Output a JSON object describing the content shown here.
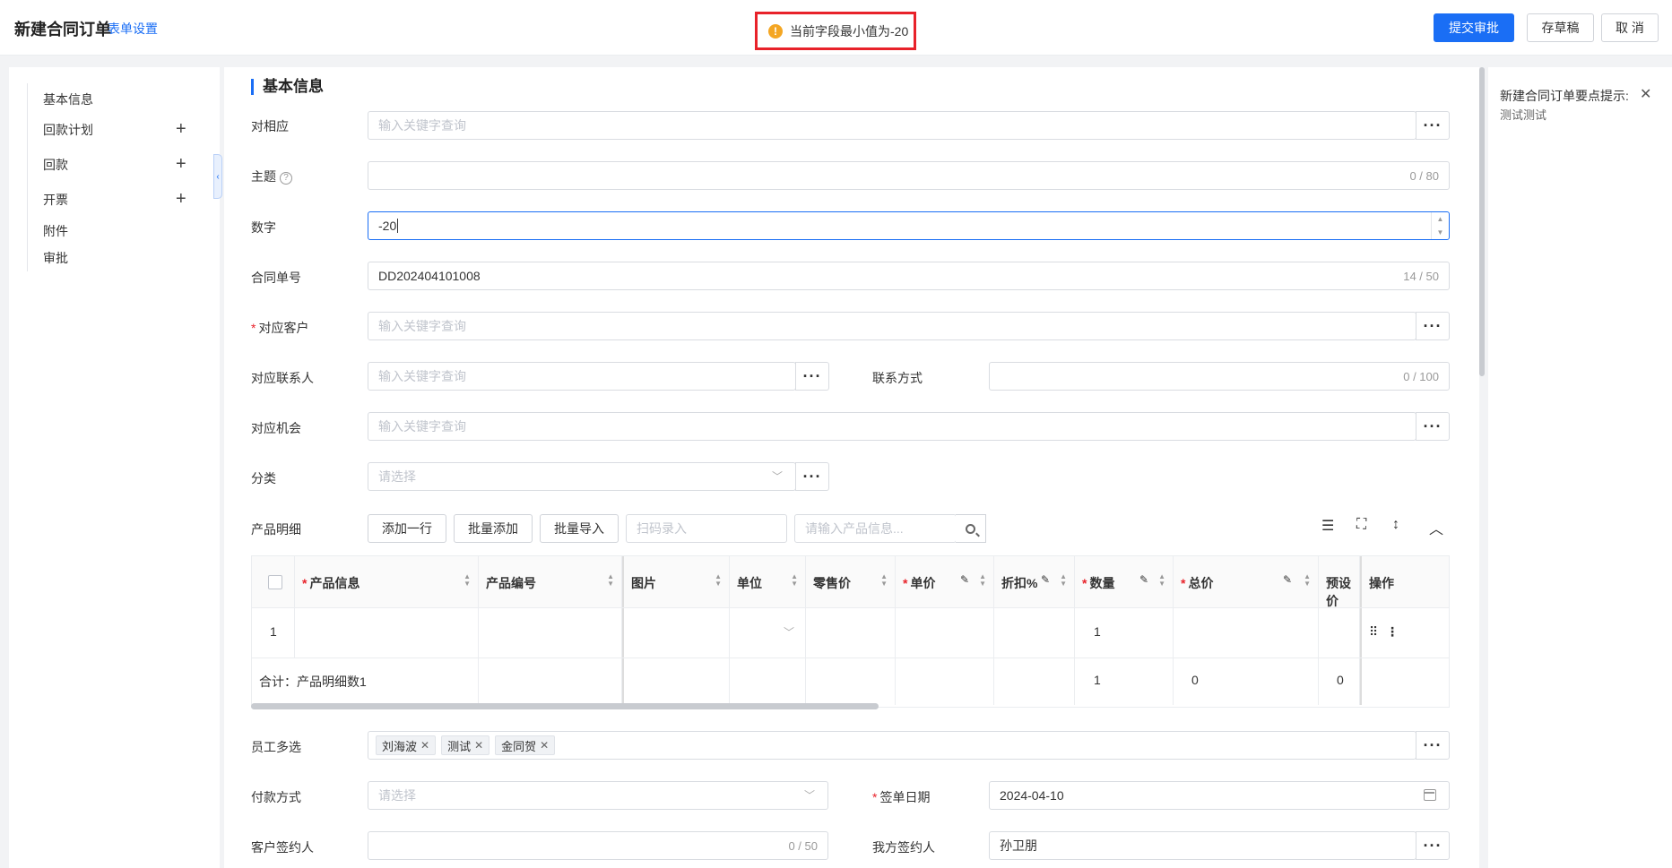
{
  "header": {
    "title": "新建合同订单",
    "form_settings": "表单设置",
    "submit_label": "提交审批",
    "draft_label": "存草稿",
    "cancel_label": "取 消"
  },
  "toast": {
    "icon": "warning-icon",
    "message": "当前字段最小值为-20",
    "color": "#f4a623"
  },
  "nav": {
    "items": [
      {
        "label": "基本信息",
        "plus": false
      },
      {
        "label": "回款计划",
        "plus": true
      },
      {
        "label": "回款",
        "plus": true
      },
      {
        "label": "开票",
        "plus": true
      },
      {
        "label": "附件",
        "plus": false
      },
      {
        "label": "审批",
        "plus": false
      }
    ],
    "collapse_icon": "chevron-left-icon"
  },
  "section": {
    "title": "基本信息"
  },
  "fields": {
    "duixiangying": {
      "label": "对相应",
      "placeholder": "输入关键字查询"
    },
    "subject": {
      "label": "主题",
      "count": "0 / 80"
    },
    "number": {
      "label": "数字",
      "value": "-20"
    },
    "contract_no": {
      "label": "合同单号",
      "value": "DD202404101008",
      "count": "14 / 50"
    },
    "customer": {
      "label": "对应客户",
      "placeholder": "输入关键字查询"
    },
    "contact": {
      "label": "对应联系人",
      "placeholder": "输入关键字查询"
    },
    "contact_method": {
      "label": "联系方式",
      "count": "0 / 100"
    },
    "opportunity": {
      "label": "对应机会",
      "placeholder": "输入关键字查询"
    },
    "category": {
      "label": "分类",
      "placeholder": "请选择"
    },
    "employees": {
      "label": "员工多选",
      "tags": [
        "刘海波",
        "测试",
        "金同贺"
      ]
    },
    "payment": {
      "label": "付款方式",
      "placeholder": "请选择"
    },
    "sign_date": {
      "label": "签单日期",
      "value": "2024-04-10"
    },
    "customer_signer": {
      "label": "客户签约人",
      "count": "0 / 50"
    },
    "our_signer": {
      "label": "我方签约人",
      "value": "孙卫朋"
    }
  },
  "product": {
    "label": "产品明细",
    "add_row": "添加一行",
    "batch_add": "批量添加",
    "batch_import": "批量导入",
    "scan_placeholder": "扫码录入",
    "search_placeholder": "请输入产品信息..."
  },
  "table": {
    "headers": [
      "产品信息",
      "产品编号",
      "图片",
      "单位",
      "零售价",
      "单价",
      "折扣%",
      "数量",
      "总价",
      "预设价",
      "操作"
    ],
    "row": {
      "index": "1",
      "quantity": "1"
    },
    "summary": {
      "label": "合计：产品明细数1",
      "quantity": "1",
      "total": "0",
      "preset": "0"
    }
  },
  "tip": {
    "title": "新建合同订单要点提示:",
    "body": "测试测试"
  },
  "colors": {
    "primary": "#1a6ef5",
    "danger": "#e8222a"
  }
}
